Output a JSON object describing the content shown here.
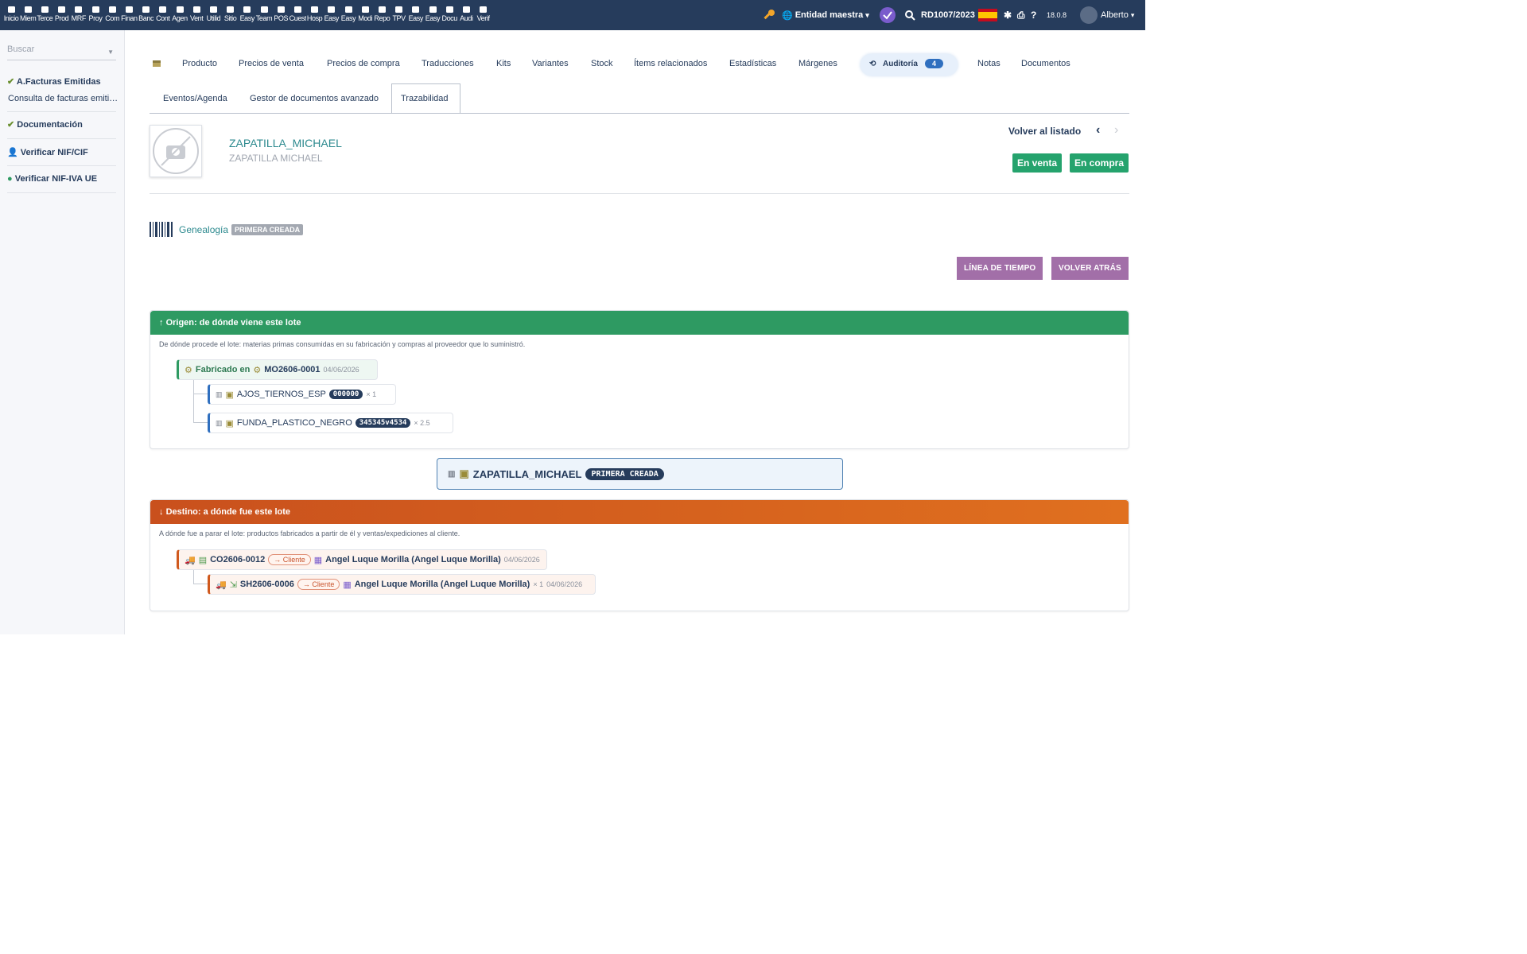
{
  "topbar": {
    "modules": [
      "Inicio",
      "Miem",
      "Terce",
      "Prod",
      "MRF",
      "Proy",
      "Com",
      "Finan",
      "Banc",
      "Cont",
      "Agen",
      "Vent",
      "Utilid",
      "Sitio",
      "Easy",
      "Team",
      "POS",
      "Cuest",
      "Hosp",
      "Easy",
      "Easy",
      "Modi",
      "Repo",
      "TPV",
      "Easy",
      "Easy",
      "Docu",
      "Audi",
      "Verif"
    ],
    "entity": "Entidad maestra",
    "record_ref": "RD1007/2023",
    "version": "18.0.8",
    "user": "Alberto"
  },
  "sidebar": {
    "search_placeholder": "Buscar",
    "items": [
      {
        "label": "A.Facturas Emitidas"
      },
      {
        "label": "Consulta de facturas emitidas"
      },
      {
        "label": "Documentación"
      },
      {
        "label": "Verificar NIF/CIF"
      },
      {
        "label": "Verificar NIF-IVA UE"
      }
    ]
  },
  "tabs": {
    "row1": [
      "Producto",
      "Precios de venta",
      "Precios de compra",
      "Traducciones",
      "Kits",
      "Variantes",
      "Stock",
      "Ítems relacionados",
      "Estadísticas",
      "Márgenes",
      "Auditoría",
      "Notas",
      "Documentos"
    ],
    "audit_count": "4",
    "row2": [
      "Eventos/Agenda",
      "Gestor de documentos avanzado",
      "Trazabilidad"
    ]
  },
  "product": {
    "ref": "ZAPATILLA_MICHAEL",
    "label": "ZAPATILLA MICHAEL",
    "back_to_list": "Volver al listado",
    "status_sell": "En venta",
    "status_buy": "En compra"
  },
  "genealogy": {
    "title": "Genealogía",
    "badge": "PRIMERA CREADA",
    "btn_timeline": "LÍNEA DE TIEMPO",
    "btn_back": "VOLVER ATRÁS"
  },
  "origin": {
    "title": "Origen: de dónde viene este lote",
    "description": "De dónde procede el lote: materias primas consumidas en su fabricación y compras al proveedor que lo suministró.",
    "made_label": "Fabricado en",
    "mo_ref": "MO2606-0001",
    "mo_date": "04/06/2026",
    "components": [
      {
        "ref": "AJOS_TIERNOS_ESP",
        "lot": "000000",
        "qty": "× 1"
      },
      {
        "ref": "FUNDA_PLASTICO_NEGRO",
        "lot": "345345v4534",
        "qty": "× 2.5"
      }
    ]
  },
  "center": {
    "ref": "ZAPATILLA_MICHAEL",
    "badge": "PRIMERA CREADA"
  },
  "destination": {
    "title": "Destino: a dónde fue este lote",
    "description": "A dónde fue a parar el lote: productos fabricados a partir de él y ventas/expediciones al cliente.",
    "order": {
      "ref": "CO2606-0012",
      "role": "→ Cliente",
      "customer": "Angel Luque Morilla (Angel Luque Morilla)",
      "date": "04/06/2026"
    },
    "shipment": {
      "ref": "SH2606-0006",
      "role": "→ Cliente",
      "customer": "Angel Luque Morilla (Angel Luque Morilla)",
      "qty": "× 1",
      "date": "04/06/2026"
    }
  },
  "colors": {
    "topbar": "#263c5c",
    "origin_header": "#2e9a62",
    "destination_header": "#d0591d",
    "action_button": "#a26fa8",
    "status_badge": "#25a36d"
  }
}
